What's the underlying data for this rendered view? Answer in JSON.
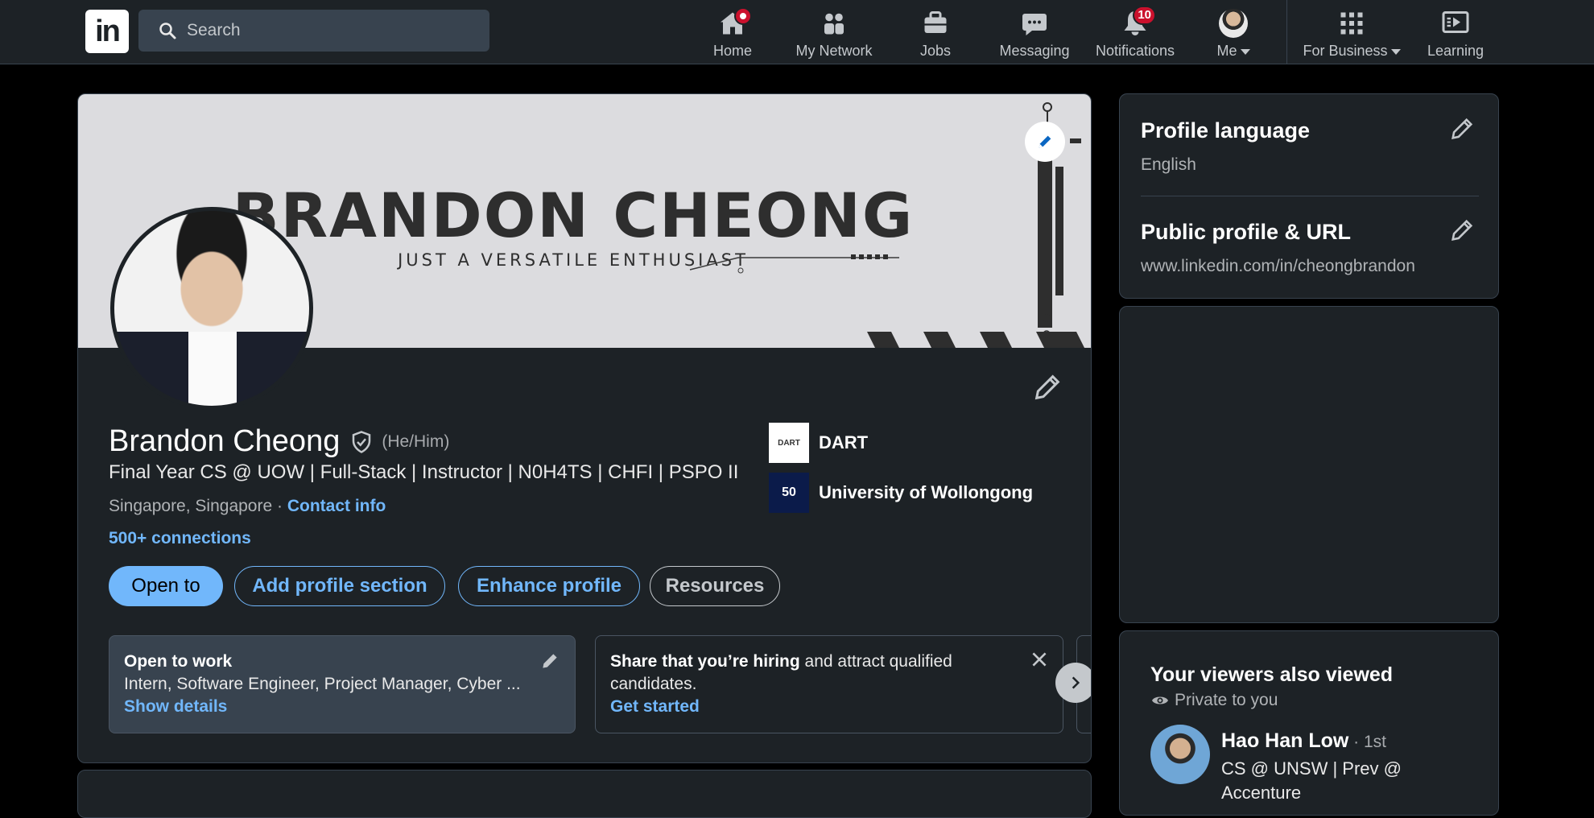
{
  "nav": {
    "search_placeholder": "Search",
    "items": [
      {
        "label": "Home"
      },
      {
        "label": "My Network"
      },
      {
        "label": "Jobs"
      },
      {
        "label": "Messaging"
      },
      {
        "label": "Notifications",
        "badge": "10"
      },
      {
        "label": "Me"
      },
      {
        "label": "For Business"
      },
      {
        "label": "Learning"
      }
    ]
  },
  "banner": {
    "name": "BRANDON CHEONG",
    "tagline": "JUST A VERSATILE ENTHUSIAST"
  },
  "profile": {
    "name": "Brandon Cheong",
    "pronouns": "(He/Him)",
    "headline": "Final Year CS @ UOW | Full-Stack | Instructor | N0H4TS | CHFI | PSPO II",
    "location": "Singapore, Singapore",
    "separator": " · ",
    "contact_label": "Contact info",
    "connections": "500+ connections",
    "orgs": [
      {
        "logo_text": "DART",
        "name": "DART"
      },
      {
        "logo_text": "50",
        "name": "University of Wollongong"
      }
    ],
    "buttons": {
      "open_to": "Open to",
      "add_section": "Add profile section",
      "enhance": "Enhance profile",
      "resources": "Resources"
    }
  },
  "promos": {
    "work": {
      "title": "Open to work",
      "detail": "Intern, Software Engineer, Project Manager, Cyber ...",
      "link": "Show details"
    },
    "hire": {
      "bold": "Share that you’re hiring",
      "rest": " and attract qualified candidates.",
      "link": "Get started"
    }
  },
  "sidebar": {
    "language_title": "Profile language",
    "language_value": "English",
    "url_title": "Public profile & URL",
    "url_value": "www.linkedin.com/in/cheongbrandon",
    "viewers_title": "Your viewers also viewed",
    "viewers_private": "Private to you",
    "viewer": {
      "name": "Hao Han Low",
      "degree": " · 1st",
      "headline": "CS @ UNSW | Prev @",
      "headline2": "Accenture"
    }
  },
  "colors": {
    "accent": "#71b7fb",
    "badge": "#cb112d",
    "card": "#1d2226"
  }
}
